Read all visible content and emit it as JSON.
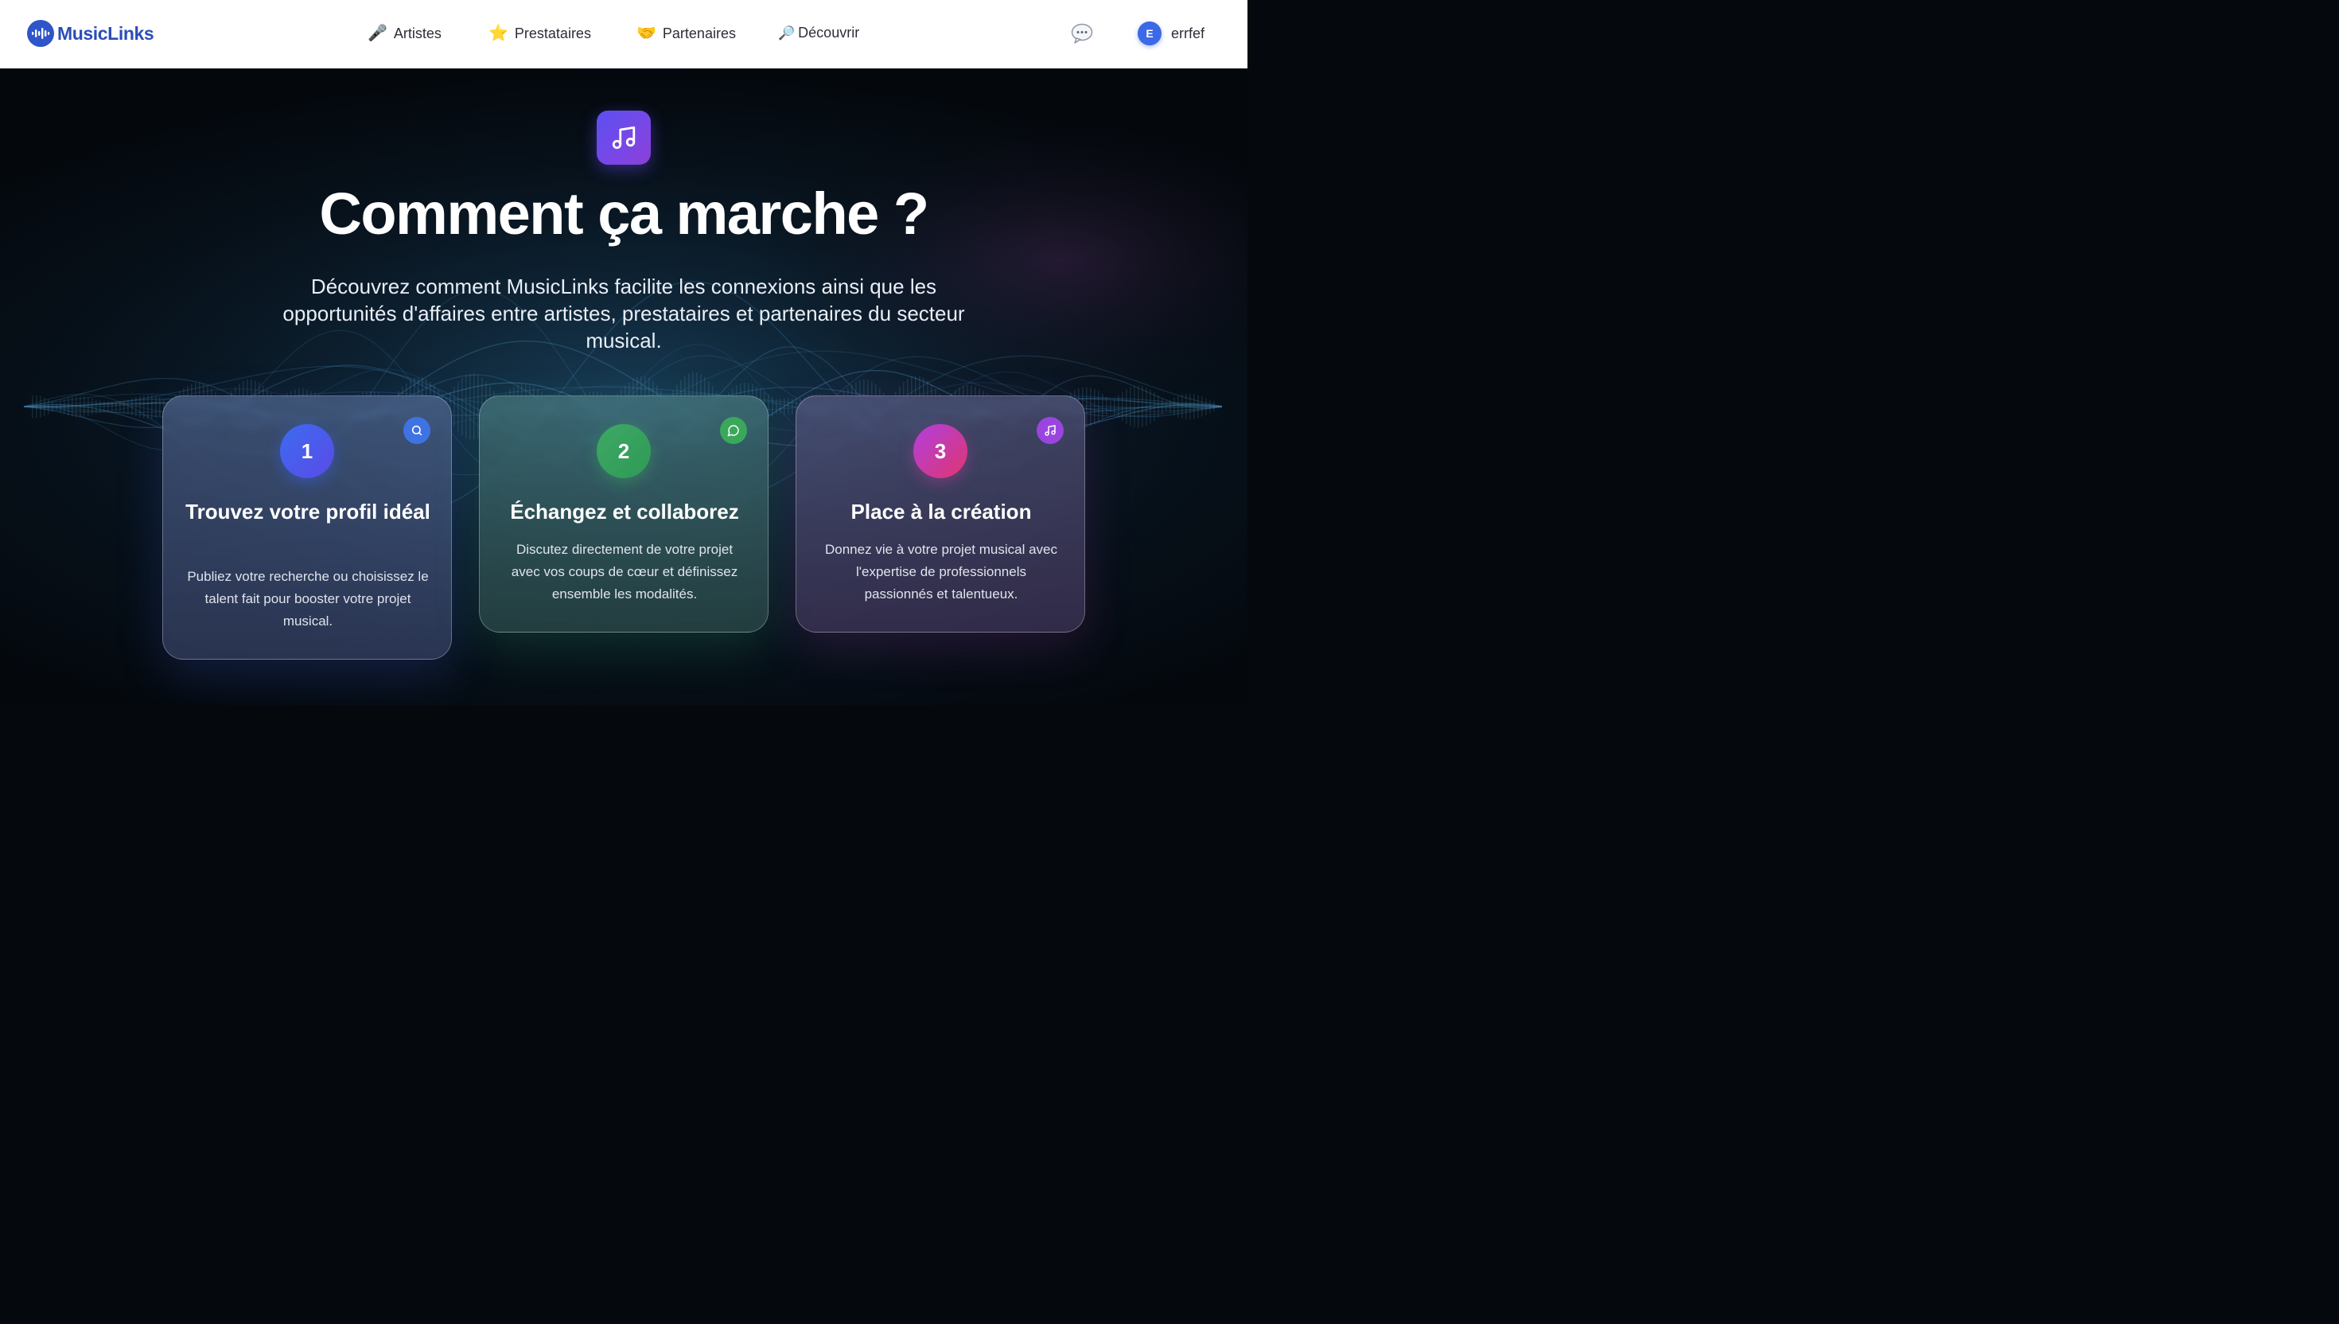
{
  "navbar": {
    "brand": "MusicLinks",
    "items": [
      {
        "label": "Artistes",
        "glyph": "🎤",
        "icon": "microphone-icon"
      },
      {
        "label": "Prestataires",
        "glyph": "⭐",
        "icon": "star-icon"
      },
      {
        "label": "Partenaires",
        "glyph": "🤝",
        "icon": "handshake-icon"
      },
      {
        "label": "Découvrir",
        "glyph": "🔎",
        "icon": "magnifier-icon"
      }
    ],
    "chat_icon": "chat-bubble-icon",
    "user": {
      "initial": "E",
      "name": "errfef"
    }
  },
  "hero": {
    "icon": "music-note-icon",
    "title": "Comment ça marche ?",
    "subtitle": "Découvrez comment MusicLinks facilite les connexions ainsi que les opportunités d'affaires entre artistes, prestataires et partenaires du secteur musical."
  },
  "steps": [
    {
      "number": "1",
      "title": "Trouvez votre profil idéal",
      "description": "Publiez votre recherche ou choisissez le talent fait pour booster votre projet musical.",
      "icon": "search-icon",
      "accent": "#3f73e4"
    },
    {
      "number": "2",
      "title": "Échangez et collaborez",
      "description": "Discutez directement de votre projet avec vos coups de cœur et définissez ensemble les modalités.",
      "icon": "message-circle-icon",
      "accent": "#3aa85a"
    },
    {
      "number": "3",
      "title": "Place à la création",
      "description": "Donnez vie à votre projet musical avec l'expertise de professionnels passionnés et talentueux.",
      "icon": "music-note-icon",
      "accent": "#9b45e0"
    }
  ],
  "colors": {
    "brand": "#2b4db8",
    "avatar": "#3d68e6",
    "hero_icon": "#6a4be8"
  }
}
